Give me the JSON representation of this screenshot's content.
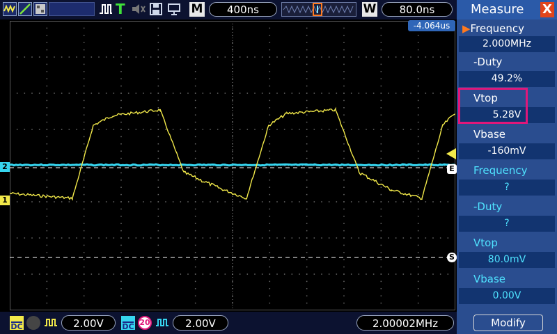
{
  "topbar": {
    "timebase_label": "M",
    "timebase_value": "400ns",
    "window_label": "W",
    "window_value": "80.0ns",
    "trigger_letter": "T",
    "trigger_offset": "-4.064us"
  },
  "measure": {
    "title": "Measure",
    "close_symbol": "X",
    "items": [
      {
        "label": "Frequency",
        "value": "2.000MHz",
        "selected": true
      },
      {
        "label": "-Duty",
        "value": "49.2%"
      },
      {
        "label": "Vtop",
        "value": "5.28V"
      },
      {
        "label": "Vbase",
        "value": "-160mV"
      },
      {
        "label": "Frequency",
        "value": "?"
      },
      {
        "label": "-Duty",
        "value": "?"
      },
      {
        "label": "Vtop",
        "value": "80.0mV"
      },
      {
        "label": "Vbase",
        "value": "0.00V"
      }
    ],
    "modify_label": "Modify"
  },
  "bottombar": {
    "ch1_coupling": "DC",
    "ch1_scale": "2.00V",
    "ch2_coupling": "DC",
    "ch2_bw": "20",
    "ch2_scale": "2.00V",
    "frequency": "2.00002MHz"
  },
  "markers": {
    "ch1": "1",
    "ch2": "2",
    "edge": "E",
    "s": "S"
  },
  "colors": {
    "ch1": "#f2e94a",
    "ch2": "#36d6f0",
    "grid": "#7f7f7f",
    "panel": "#2a4d8f",
    "highlight": "#e0177a"
  }
}
